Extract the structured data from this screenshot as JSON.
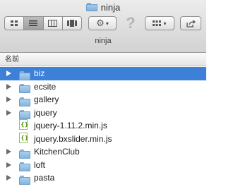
{
  "window": {
    "title": "ninja"
  },
  "toolbar": {
    "view_modes": [
      {
        "name": "icon-view",
        "icon": "icon-grid-icon"
      },
      {
        "name": "list-view",
        "icon": "list-lines-icon",
        "active": true
      },
      {
        "name": "column-view",
        "icon": "columns-icon"
      },
      {
        "name": "coverflow-view",
        "icon": "coverflow-icon"
      }
    ],
    "action_icon": "gear-icon",
    "quicklook_icon": "question-mark-icon",
    "arrange_icon": "grid-arrange-icon",
    "share_icon": "share-arrow-icon",
    "label": "ninja"
  },
  "columns": {
    "name": "名前"
  },
  "files": [
    {
      "name": "biz",
      "type": "folder",
      "selected": true
    },
    {
      "name": "ecsite",
      "type": "folder"
    },
    {
      "name": "gallery",
      "type": "folder"
    },
    {
      "name": "jquery",
      "type": "folder"
    },
    {
      "name": "jquery-1.11.2.min.js",
      "type": "js"
    },
    {
      "name": "jquery.bxslider.min.js",
      "type": "js"
    },
    {
      "name": "KitchenClub",
      "type": "folder"
    },
    {
      "name": "loft",
      "type": "folder"
    },
    {
      "name": "pasta",
      "type": "folder"
    }
  ],
  "colors": {
    "selection": "#3d80d8",
    "folder": "#84b5de",
    "js_mark": "#5b9a1c"
  }
}
